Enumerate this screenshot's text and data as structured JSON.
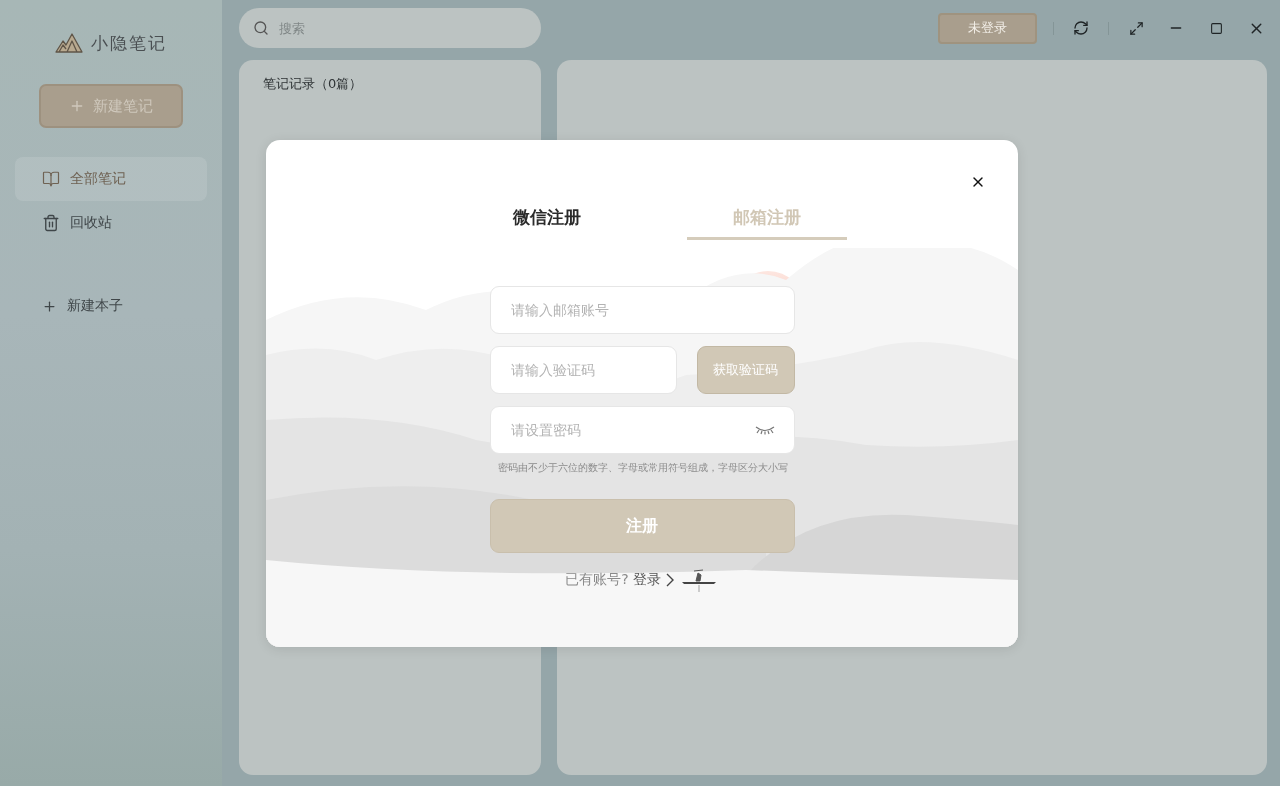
{
  "app": {
    "name": "小隐笔记"
  },
  "sidebar": {
    "new_note": "新建笔记",
    "items": [
      {
        "kind": "notes",
        "label": "全部笔记",
        "selected": true
      },
      {
        "kind": "trash",
        "label": "回收站",
        "selected": false
      }
    ],
    "new_notebook": "新建本子"
  },
  "search": {
    "placeholder": "搜索"
  },
  "note_list": {
    "title": "笔记记录（0篇）"
  },
  "top_bar": {
    "login_status": "未登录"
  },
  "dialog": {
    "tabs": [
      {
        "label": "微信注册",
        "selected": false
      },
      {
        "label": "邮箱注册",
        "selected": true
      }
    ],
    "fields": [
      {
        "kind": "text",
        "placeholder": "请输入邮箱账号"
      },
      {
        "kind": "code",
        "placeholder": "请输入验证码",
        "button": "获取验证码"
      },
      {
        "kind": "password",
        "placeholder": "请设置密码"
      }
    ],
    "password_hint": "密码由不少于六位的数字、字母或常用符号组成，字母区分大小写",
    "submit": "注册",
    "footer_text": "已有账号?",
    "footer_link": "登录"
  }
}
